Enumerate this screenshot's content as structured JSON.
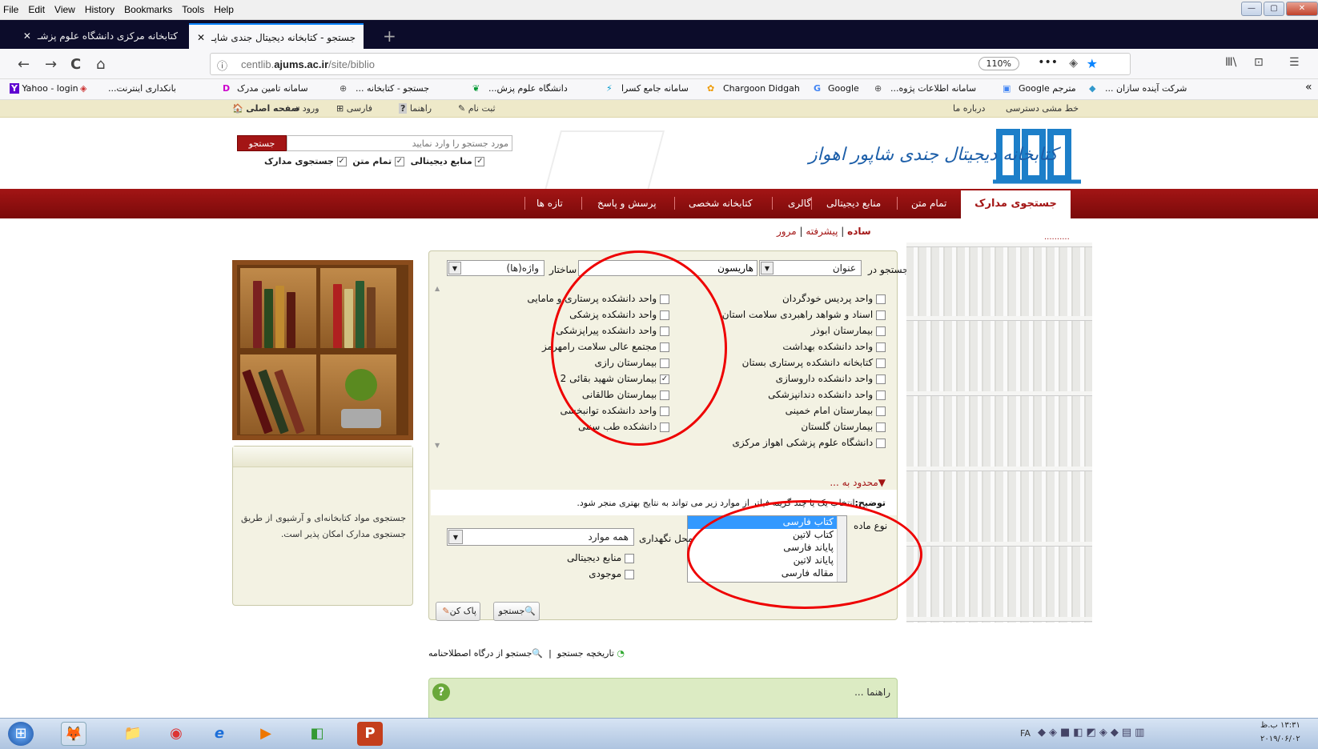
{
  "menubar": {
    "items": [
      "File",
      "Edit",
      "View",
      "History",
      "Bookmarks",
      "Tools",
      "Help"
    ]
  },
  "tabs": [
    {
      "label": "کتابخانه مرکزی دانشگاه علوم پزشـ",
      "close": "✕"
    },
    {
      "label": "جستجو - کتابخانه دیجیتال جندی شاپـ",
      "close": "✕"
    }
  ],
  "nav": {
    "back": "←",
    "forward": "→",
    "reload": "C",
    "home": "⌂",
    "info": "ⓘ",
    "url_prefix": "centlib.",
    "url_domain": "ajums.ac.ir",
    "url_path": "/site/biblio",
    "zoom": "110%",
    "more": "•••",
    "pocket": "◈",
    "star": "★",
    "library": "Ⅲ\\",
    "sidebar": "⊡",
    "menu": "☰"
  },
  "bookmarks": [
    "Yahoo - login",
    "بانکداری اینترنت...",
    "سامانه تامین مدرک",
    "جستجو - کتابخانه ...",
    "دانشگاه علوم پزش...",
    "سامانه جامع کسرا",
    "Chargoon Didgah",
    "Google",
    "سامانه اطلاعات پژوه...",
    "مترجم Google",
    "شرکت آینده سازان ..."
  ],
  "bm_more": "»",
  "topstrip": {
    "home": "صفحه اصلی",
    "login": "ورود",
    "lang": "فارسی",
    "help": "راهنما",
    "register": "ثبت نام",
    "about": "درباره ما",
    "policy": "خط مشی دسترسی"
  },
  "logo": {
    "text": "کتابخانه دیجیتال جندی شاپور اهواز"
  },
  "topsearch": {
    "placeholder": "مورد جستجو را وارد نمایید",
    "button": "جستجو",
    "opt1": "جستجوی مدارک",
    "opt2": "تمام متن",
    "opt3": "منابع دیجیتالی"
  },
  "mainnav": [
    "جستجوی مدارک",
    "تمام متن",
    "منابع دیجیتالی",
    "گالری",
    "کتابخانه شخصی",
    "پرسش و پاسخ",
    "تازه ها"
  ],
  "modes": {
    "simple": "ساده",
    "advanced": "پیشرفته",
    "browse": "مرور",
    "sep": "|"
  },
  "dots": "..........",
  "form": {
    "search_in": "جستجو در",
    "field": "عنوان",
    "term": "هاریسون",
    "struct": "ساختار",
    "struct_val": "واژه(ها)",
    "right_list": [
      {
        "label": "واحد پردیس خودگردان",
        "checked": false
      },
      {
        "label": "اسناد و شواهد راهبردی سلامت استان",
        "checked": false
      },
      {
        "label": "بیمارستان ابوذر",
        "checked": false
      },
      {
        "label": "واحد دانشکده بهداشت",
        "checked": false
      },
      {
        "label": "کتابخانه دانشکده پرستاری بستان",
        "checked": false
      },
      {
        "label": "واحد دانشکده داروسازی",
        "checked": false
      },
      {
        "label": "واحد دانشکده دندانپزشکی",
        "checked": false
      },
      {
        "label": "بیمارستان امام خمینی",
        "checked": false
      },
      {
        "label": "بیمارستان گلستان",
        "checked": false
      },
      {
        "label": "دانشگاه علوم پزشکی اهواز مرکزی",
        "checked": false
      }
    ],
    "left_list": [
      {
        "label": "واحد دانشکده پرستاری و مامایی",
        "checked": false
      },
      {
        "label": "واحد دانشکده پزشکی",
        "checked": false
      },
      {
        "label": "واحد دانشکده پیراپزشکی",
        "checked": false
      },
      {
        "label": "مجتمع عالی سلامت رامهرمز",
        "checked": false
      },
      {
        "label": "بیمارستان رازی",
        "checked": false
      },
      {
        "label": "بیمارستان شهید بقائی 2",
        "checked": true
      },
      {
        "label": "بیمارستان طالقانی",
        "checked": false
      },
      {
        "label": "واحد دانشکده توانبخشی",
        "checked": false
      },
      {
        "label": "دانشکده طب سنتی",
        "checked": false
      }
    ],
    "limit": "▼محدود به ...",
    "note_bold": "توضیح:",
    "note": "انتخاب یک یا چند گزینه فیلتر از موارد زیر می تواند به نتایج بهتری منجر شود.",
    "mattype": "نوع ماده",
    "mat_options": [
      "کتاب فارسی",
      "کتاب لاتین",
      "پایاند فارسی",
      "پایاند لاتین",
      "مقاله فارسی"
    ],
    "location": "محل نگهداری",
    "location_val": "همه موارد",
    "digital": "منابع دیجیتالی",
    "available": "موجودی",
    "search_btn": "جستجو",
    "clear_btn": "پاک کن",
    "history": "تاریخچه جستجو",
    "thesaurus": "جستجو از درگاه اصطلاحنامه",
    "guide": "راهنما ..."
  },
  "sidebox": {
    "text": "جستجوی مواد کتابخانه‌ای و آرشیوی از طریق جستجوی مدارک امکان پذیر است."
  },
  "tray": {
    "lang": "FA",
    "time": "۱۳:۳۱ ب.ظ",
    "date": "۲۰۱۹/۰۶/۰۲"
  },
  "taskbar": {
    "start": "⊞",
    "items": [
      "🦊",
      "📁",
      "◉",
      "e",
      "▶",
      "◧",
      "P"
    ]
  }
}
